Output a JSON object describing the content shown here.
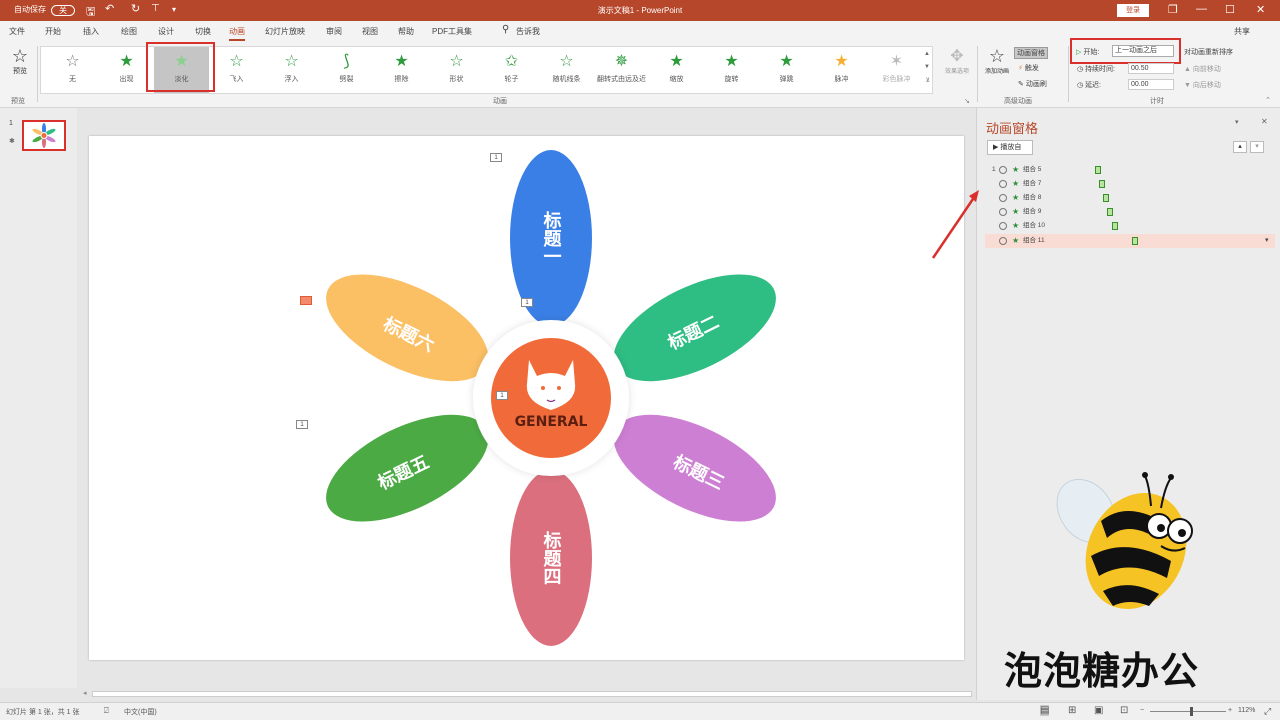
{
  "titlebar": {
    "autosave": "自动保存",
    "toggle": "关",
    "doc_title": "演示文稿1 - PowerPoint",
    "login": "登录",
    "restore": "❐",
    "minimize": "—",
    "maximize": "☐",
    "close": "✕"
  },
  "tabs": [
    "文件",
    "开始",
    "插入",
    "绘图",
    "设计",
    "切换",
    "动画",
    "幻灯片放映",
    "审阅",
    "视图",
    "帮助",
    "PDF工具集"
  ],
  "active_tab": "动画",
  "tellme": "告诉我",
  "share": "共享",
  "ribbon": {
    "preview_label": "预览",
    "preview_group": "预览",
    "effects": [
      "无",
      "出现",
      "淡化",
      "飞入",
      "浮入",
      "劈裂",
      "擦除",
      "形状",
      "轮子",
      "随机线条",
      "翻转式由远及近",
      "缩放",
      "旋转",
      "弹跳",
      "脉冲",
      "彩色脉冲"
    ],
    "selected_effect": "淡化",
    "effect_group_title": "动画",
    "effect_options": "效果选项",
    "add_animation": "添加动画",
    "animation_pane_btn": "动画窗格",
    "trigger": "触发",
    "anim_painter": "动画刷",
    "advanced_group": "高级动画",
    "start_label": "开始:",
    "start_value": "上一动画之后",
    "duration_label": "持续时间:",
    "duration_value": "00.50",
    "delay_label": "延迟:",
    "delay_value": "00.00",
    "reorder": "对动画重新排序",
    "move_earlier": "向前移动",
    "move_later": "向后移动",
    "timing_group": "计时"
  },
  "thumbs": {
    "number": "1"
  },
  "slide": {
    "center_text": "GENERAL",
    "petals": [
      "标题一",
      "标题二",
      "标题三",
      "标题四",
      "标题五",
      "标题六"
    ],
    "anim_tags": [
      "1",
      "1",
      "1",
      "1"
    ],
    "petal_colors": [
      "#3a7fe6",
      "#2ebd83",
      "#cd7fd3",
      "#db6f7d",
      "#4caa45",
      "#fbbf64"
    ],
    "center_color": "#f16b3a"
  },
  "anim_pane": {
    "title": "动画窗格",
    "play_label": "▶ 播放自",
    "items": [
      {
        "idx": "1",
        "name": "组合 5",
        "sel": false
      },
      {
        "idx": "",
        "name": "组合 7",
        "sel": false
      },
      {
        "idx": "",
        "name": "组合 8",
        "sel": false
      },
      {
        "idx": "",
        "name": "组合 9",
        "sel": false
      },
      {
        "idx": "",
        "name": "组合 10",
        "sel": false
      },
      {
        "idx": "",
        "name": "组合 11",
        "sel": true
      }
    ]
  },
  "watermark": "泡泡糖办公",
  "status": {
    "slide_info": "幻灯片 第 1 张，共 1 张",
    "language": "中文(中国)",
    "zoom": "112%"
  }
}
